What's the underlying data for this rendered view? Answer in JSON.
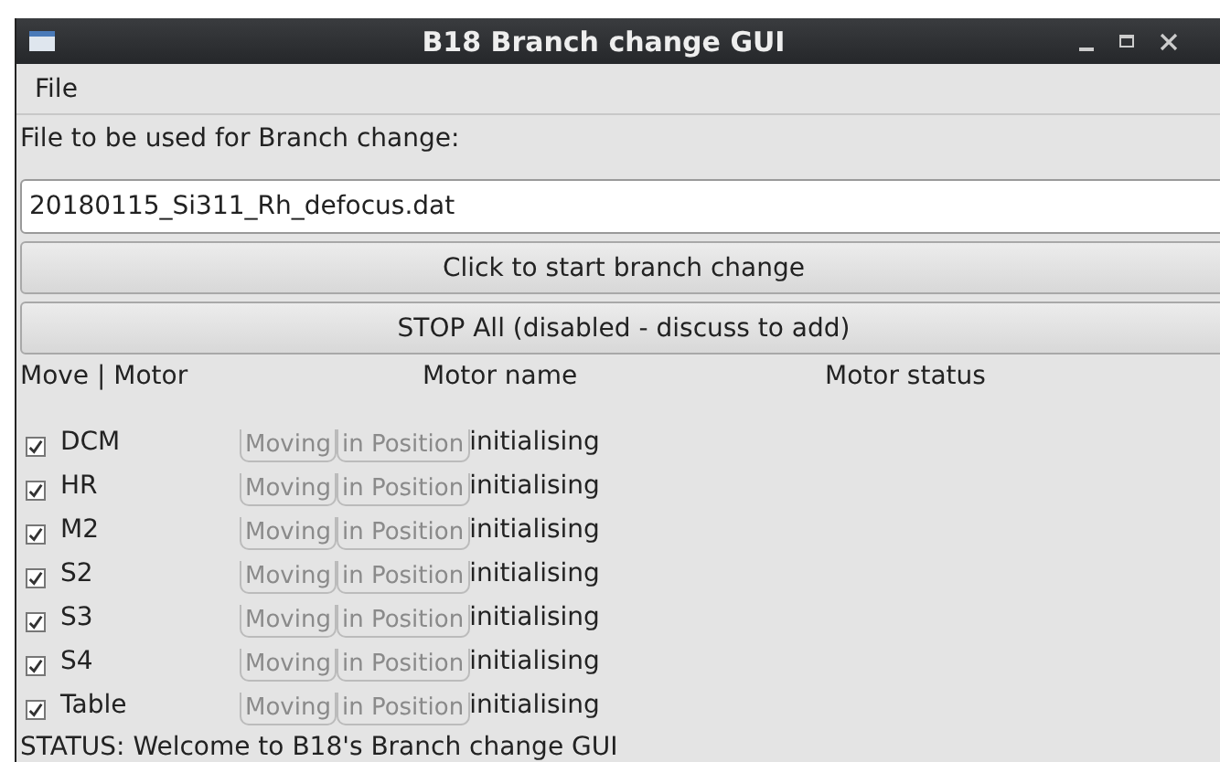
{
  "window": {
    "title": "B18 Branch change GUI"
  },
  "menu": [
    "File"
  ],
  "file_label": "File to be used for Branch change:",
  "file_field": {
    "value": "20180115_Si311_Rh_defocus.dat"
  },
  "buttons": [
    {
      "label": "Click to start branch change"
    },
    {
      "label": "STOP All (disabled - discuss to add)"
    }
  ],
  "columns": [
    "Move | Motor",
    "Motor name",
    "Motor status"
  ],
  "motors": [
    {
      "name": "DCM",
      "checked": true,
      "indicators": [
        {
          "label": "Moving",
          "on": false
        },
        {
          "label": "in Position",
          "on": false
        }
      ],
      "status": "initialising"
    },
    {
      "name": "HR",
      "checked": true,
      "indicators": [
        {
          "label": "Moving",
          "on": false
        },
        {
          "label": "in Position",
          "on": false
        }
      ],
      "status": "initialising"
    },
    {
      "name": "M2",
      "checked": true,
      "indicators": [
        {
          "label": "Moving",
          "on": false
        },
        {
          "label": "in Position",
          "on": false
        }
      ],
      "status": "initialising"
    },
    {
      "name": "S2",
      "checked": true,
      "indicators": [
        {
          "label": "Moving",
          "on": false
        },
        {
          "label": "in Position",
          "on": false
        }
      ],
      "status": "initialising"
    },
    {
      "name": "S3",
      "checked": true,
      "indicators": [
        {
          "label": "Moving",
          "on": false
        },
        {
          "label": "in Position",
          "on": false
        }
      ],
      "status": "initialising"
    },
    {
      "name": "S4",
      "checked": true,
      "indicators": [
        {
          "label": "Moving",
          "on": false
        },
        {
          "label": "in Position",
          "on": false
        }
      ],
      "status": "initialising"
    },
    {
      "name": "Table",
      "checked": true,
      "indicators": [
        {
          "label": "Moving",
          "on": false
        },
        {
          "label": "in Position",
          "on": false
        }
      ],
      "status": "initialising"
    }
  ],
  "status_bar": "STATUS: Welcome to B18's Branch change GUI"
}
